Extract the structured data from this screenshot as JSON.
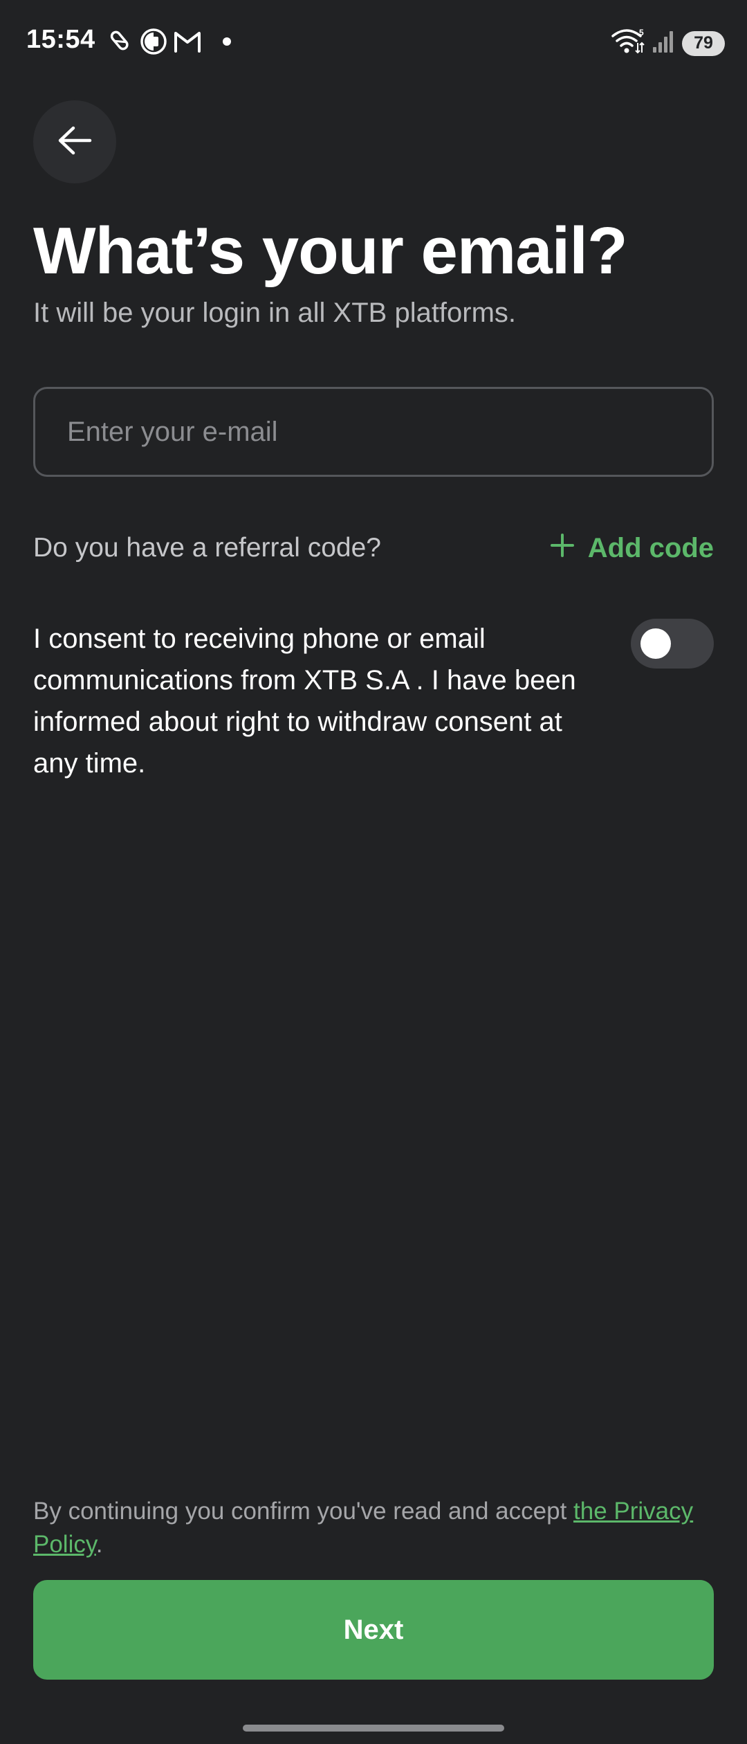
{
  "status_bar": {
    "time": "15:54",
    "battery": "79",
    "notification_icons": [
      "pen-icon",
      "vpn-icon",
      "gmail-icon",
      "dot-icon"
    ],
    "system_icons": [
      "wifi-icon",
      "signal-icon",
      "battery-icon"
    ],
    "wifi_badge": "5"
  },
  "header": {
    "back_icon": "arrow-left-icon",
    "title": "What’s your email?",
    "subtitle": "It will be your login in all XTB platforms."
  },
  "email": {
    "placeholder": "Enter your e-mail",
    "value": ""
  },
  "referral": {
    "question": "Do you have a referral code?",
    "add_icon": "plus-icon",
    "add_label": "Add code"
  },
  "consent": {
    "text": "I consent to receiving phone or email communications from XTB S.A . I have been informed about right to withdraw consent at any time.",
    "enabled": false
  },
  "footer": {
    "privacy_prefix": "By continuing you confirm you've read and accept ",
    "privacy_link": "the Privacy Policy",
    "privacy_suffix": ".",
    "next_label": "Next"
  },
  "colors": {
    "background": "#212224",
    "accent": "#4ba65b",
    "link": "#5cb86a"
  }
}
